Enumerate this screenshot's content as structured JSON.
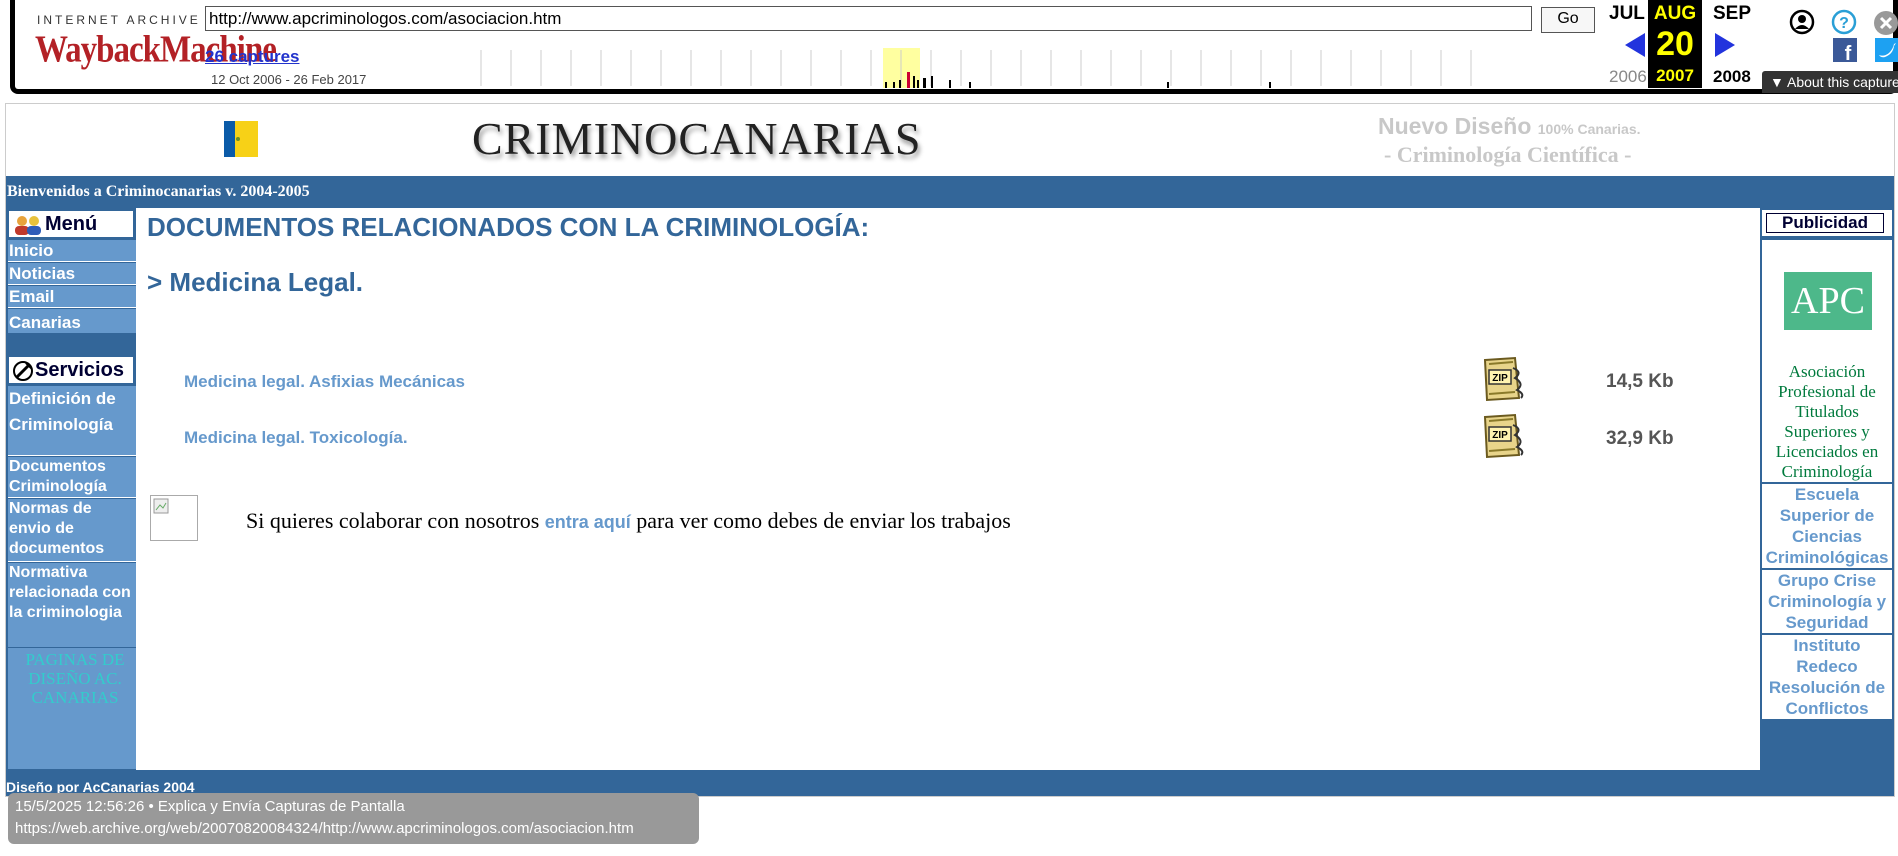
{
  "wayback": {
    "logo_top": "INTERNET ARCHIVE",
    "logo_main": "WaybackMachine",
    "url": "http://www.apcriminologos.com/asociacion.htm",
    "go_label": "Go",
    "captures_label": "26 captures",
    "date_range": "12 Oct 2006 - 26 Feb 2017",
    "prev_month": "JUL",
    "current_month": "AUG",
    "next_month": "SEP",
    "current_day": "20",
    "prev_year": "2006",
    "current_year": "2007",
    "next_year": "2008",
    "about_label": "About this capture"
  },
  "header": {
    "title": "CRIMINOCANARIAS",
    "tagline_1": "Nuevo Diseño",
    "tagline_1_small": "100% Canarias.",
    "tagline_2": "- Criminología Científica -"
  },
  "welcome": "Bienvenidos a Criminocanarias v. 2004-2005",
  "sidebar": {
    "menu_title": "Menú",
    "menu_items": [
      {
        "label": "Inicio"
      },
      {
        "label": "Noticias"
      },
      {
        "label": "Email"
      },
      {
        "label": "Canarias"
      }
    ],
    "services_title": "Servicios",
    "service_items": [
      {
        "label": "Definición de Criminología"
      },
      {
        "label": "Documentos Criminología"
      },
      {
        "label": "Normas de envio de documentos"
      },
      {
        "label": "Normativa relacionada con la criminologia"
      }
    ],
    "promo": "PAGINAS DE DISEÑO AC. CANARIAS"
  },
  "main": {
    "heading": "DOCUMENTOS RELACIONADOS CON LA CRIMINOLOGÍA:",
    "subheading": "> Medicina Legal.",
    "documents": [
      {
        "title": "Medicina legal. Asfixias Mecánicas",
        "size": "14,5 Kb",
        "icon": "zip-icon"
      },
      {
        "title": "Medicina legal. Toxicología.",
        "size": "32,9 Kb",
        "icon": "zip-icon"
      }
    ],
    "collab_before": "Si quieres colaborar con nosotros",
    "collab_link": "entra aquí",
    "collab_after": "para ver como debes de enviar los trabajos"
  },
  "right": {
    "ads_title": "Publicidad",
    "apc_logo": "APC",
    "apc_text": "Asociación Profesional de Titulados Superiores y Licenciados en Criminología",
    "ads": [
      {
        "label": "Escuela Superior de Ciencias Criminológicas"
      },
      {
        "label": "Grupo Crise Criminología y Seguridad"
      },
      {
        "label": "Instituto Redeco Resolución de Conflictos"
      }
    ]
  },
  "footer": "Diseño por AcCanarias 2004",
  "overlay": {
    "line1": "15/5/2025 12:56:26 • Explica y Envía Capturas de Pantalla",
    "line2": "https://web.archive.org/web/20070820084324/http://www.apcriminologos.com/asociacion.htm"
  },
  "colors": {
    "nav_blue": "#336699",
    "link_blue": "#6699cc",
    "promo_cyan": "#33cccc",
    "apc_green": "#4db88a"
  }
}
